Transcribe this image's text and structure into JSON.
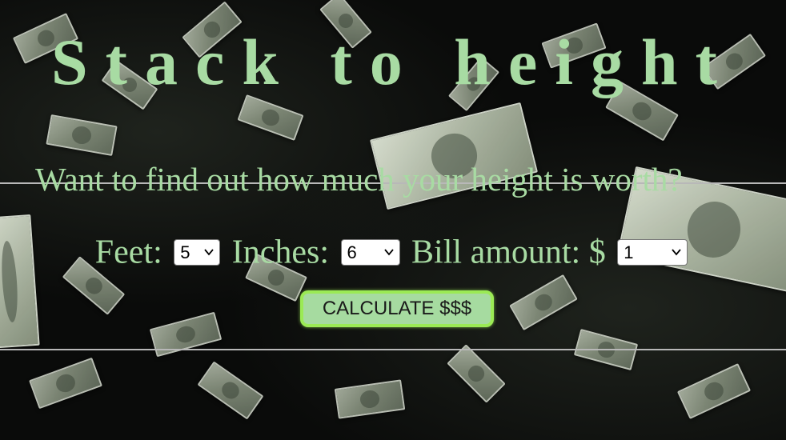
{
  "page": {
    "title": "Stack to height"
  },
  "form": {
    "legend": "Want to find out how much your height is worth?",
    "feet_label": "Feet:",
    "feet_value": "5",
    "inches_label": "Inches:",
    "inches_value": "6",
    "bill_label": "Bill amount: $",
    "bill_value": "1",
    "calculate_label": "CALCULATE $$$"
  },
  "colors": {
    "text_green": "#a8dba3",
    "button_fill": "#a6dba0",
    "button_border": "#9bea55",
    "background": "#0a0b0a"
  },
  "background": {
    "description_icon": "falling-money-background"
  }
}
